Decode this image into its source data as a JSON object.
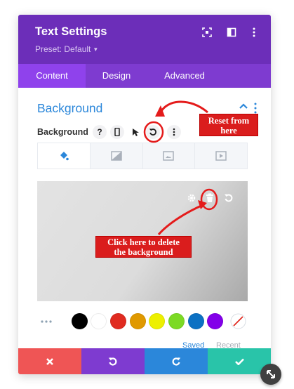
{
  "header": {
    "title": "Text Settings",
    "preset": "Preset: Default",
    "icons": [
      "focus-icon",
      "sidebar-toggle-icon",
      "more-vertical-icon"
    ]
  },
  "tabs": [
    {
      "label": "Content",
      "active": true
    },
    {
      "label": "Design",
      "active": false
    },
    {
      "label": "Advanced",
      "active": false
    }
  ],
  "section": {
    "title": "Background",
    "expanded": true
  },
  "field": {
    "label": "Background",
    "controls": [
      "help-icon",
      "responsive-phone-icon",
      "hover-cursor-icon",
      "reset-icon",
      "more-vertical-icon"
    ]
  },
  "background_types": [
    {
      "icon": "paint-bucket-icon",
      "active": true
    },
    {
      "icon": "gradient-icon",
      "active": false
    },
    {
      "icon": "image-icon",
      "active": false
    },
    {
      "icon": "video-icon",
      "active": false
    }
  ],
  "preview": {
    "actions": [
      "settings-gear-icon",
      "trash-icon",
      "reset-icon"
    ]
  },
  "swatches": {
    "colors": [
      "#000000",
      "#ffffff",
      "#e02b20",
      "#e09900",
      "#edf000",
      "#7cda24",
      "#0c71c3",
      "#8300e9"
    ],
    "saved_label": "Saved",
    "recent_label": "Recent"
  },
  "footer": {
    "buttons": [
      "cancel-x-icon",
      "undo-icon",
      "redo-icon",
      "save-check-icon"
    ]
  },
  "annotations": {
    "reset_callout": [
      "Reset from",
      "here"
    ],
    "delete_callout": [
      "Click here to delete",
      "the background"
    ]
  }
}
